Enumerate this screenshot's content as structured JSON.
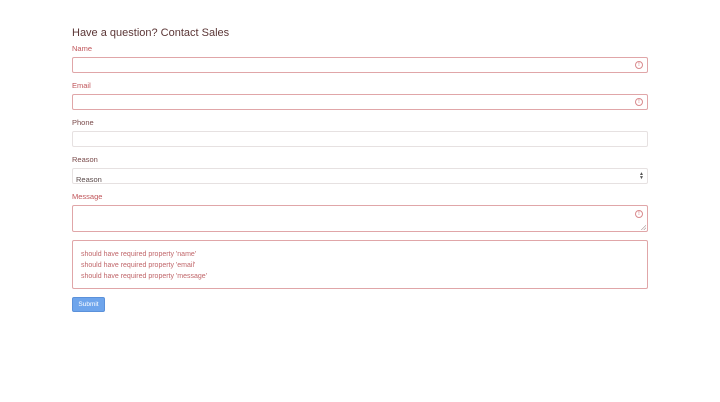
{
  "form": {
    "title": "Have a question? Contact Sales",
    "fields": {
      "name": {
        "label": "Name",
        "value": "",
        "status": "error"
      },
      "email": {
        "label": "Email",
        "value": "",
        "status": "error"
      },
      "phone": {
        "label": "Phone",
        "value": "",
        "status": "ok"
      },
      "reason": {
        "label": "Reason",
        "selected": "Reason"
      },
      "message": {
        "label": "Message",
        "value": "",
        "status": "error"
      }
    },
    "errors": [
      "should have required property 'name'",
      "should have required property 'email'",
      "should have required property 'message'"
    ],
    "submit_label": "Submit"
  },
  "icons": {
    "field_error": "exclamation-circle-icon",
    "select_arrows": "chevron-up-down-icon"
  },
  "colors": {
    "error": "#c0555a",
    "error_border": "#e0a6a8",
    "submit_bg": "#6ea5ec"
  }
}
